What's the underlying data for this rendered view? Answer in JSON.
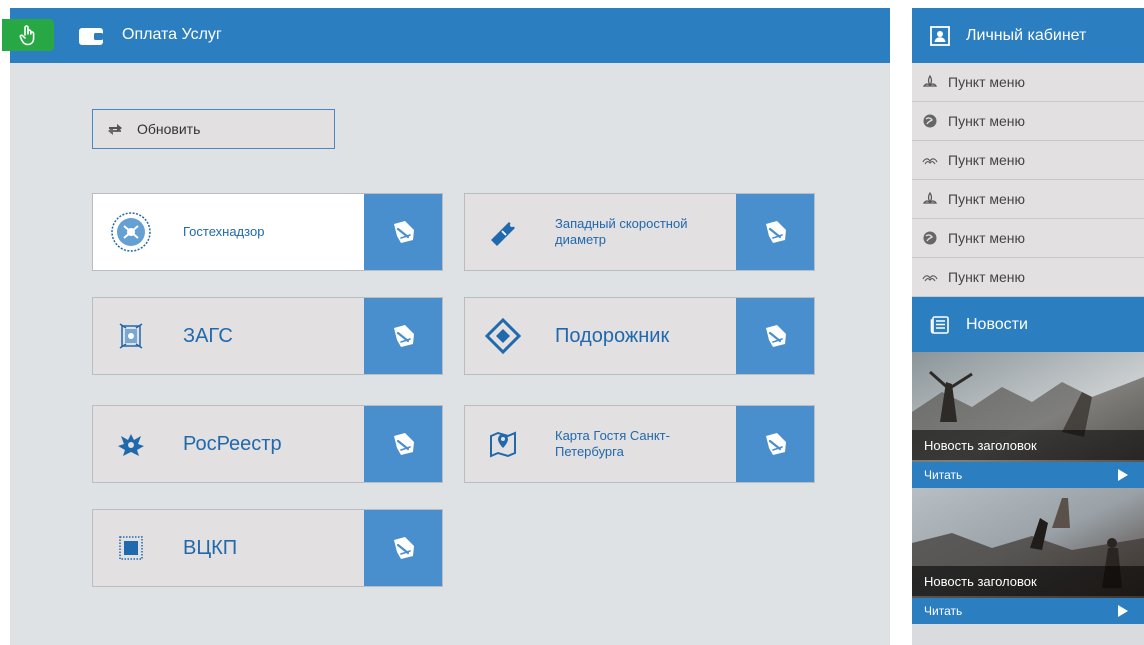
{
  "main": {
    "title": "Оплата Услуг",
    "refresh_label": "Обновить"
  },
  "services": [
    {
      "label": "Гостехнадзор",
      "icon": "emblem-icon",
      "active": true
    },
    {
      "label": "Западный скоростной диаметр",
      "icon": "road-ticket-icon",
      "active": false
    },
    {
      "label": "ЗАГС",
      "icon": "coat-of-arms-icon",
      "active": false
    },
    {
      "label": "Подорожник",
      "icon": "travel-card-icon",
      "active": false
    },
    {
      "label": "РосРеестр",
      "icon": "eagle-icon",
      "active": false
    },
    {
      "label": "Карта Гостя Санкт-Петербурга",
      "icon": "map-pin-icon",
      "active": false
    },
    {
      "label": "ВЦКП",
      "icon": "grid-logo-icon",
      "active": false
    }
  ],
  "sidebar": {
    "cabinet_title": "Личный кабинет",
    "menu": [
      {
        "label": "Пункт меню",
        "icon": "lotus-icon"
      },
      {
        "label": "Пункт меню",
        "icon": "globe-icon"
      },
      {
        "label": "Пункт меню",
        "icon": "wings-icon"
      },
      {
        "label": "Пункт меню",
        "icon": "lotus-icon"
      },
      {
        "label": "Пункт меню",
        "icon": "globe-icon"
      },
      {
        "label": "Пункт меню",
        "icon": "wings-icon"
      }
    ],
    "news_title": "Новости",
    "news": [
      {
        "title": "Новость заголовок",
        "read_label": "Читать"
      },
      {
        "title": "Новость заголовок",
        "read_label": "Читать"
      }
    ]
  },
  "colors": {
    "header_blue": "#2b7ec0",
    "pay_blue": "#4a8fcd",
    "badge_green": "#28a745",
    "panel_bg": "#dfe2e5",
    "tile_bg": "#e2e0e1",
    "label_blue": "#2169ad"
  }
}
